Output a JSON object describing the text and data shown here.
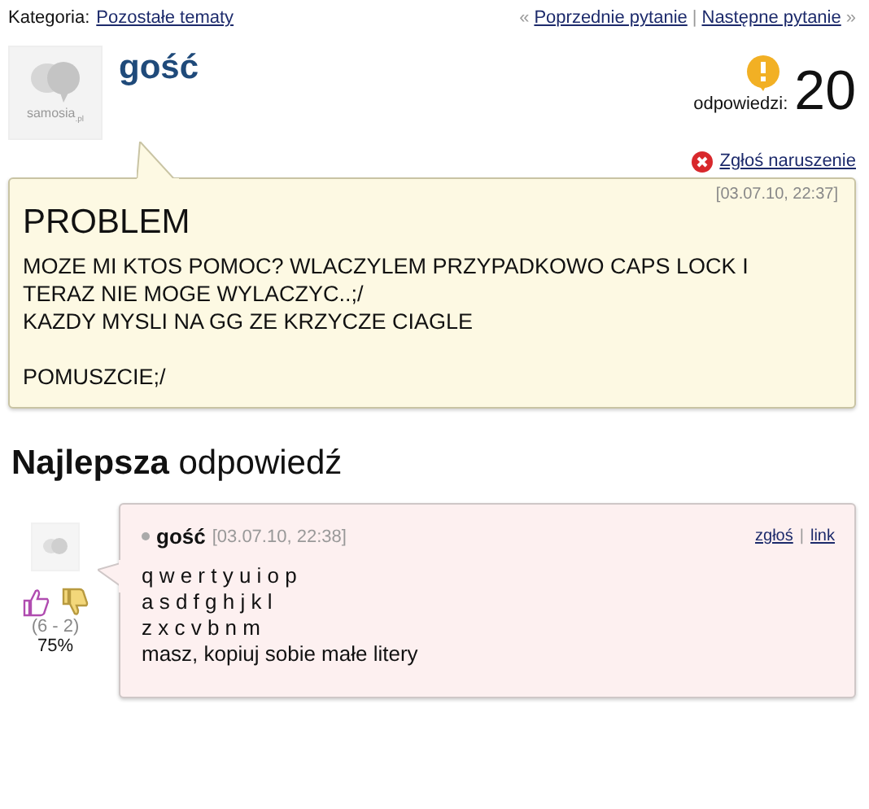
{
  "breadcrumb": {
    "label": "Kategoria:",
    "category": "Pozostałe tematy"
  },
  "nav": {
    "prev_mark": "«",
    "prev": "Poprzednie pytanie",
    "separator": "|",
    "next": "Następne pytanie",
    "next_mark": "»"
  },
  "question": {
    "avatar_text": "samosia",
    "avatar_suffix": ".pl",
    "author": "gość",
    "answers_label": "odpowiedzi:",
    "answers_count": "20",
    "report": "Zgłoś naruszenie",
    "date": "[03.07.10, 22:37]",
    "title": "PROBLEM",
    "paragraphs": [
      [
        "MOZE MI KTOS POMOC? WLACZYLEM PRZYPADKOWO CAPS LOCK I TERAZ NIE MOGE WYLACZYC..;/",
        "KAZDY MYSLI NA GG ZE KRZYCZE CIAGLE"
      ],
      [
        "POMUSZCIE;/"
      ]
    ]
  },
  "best_answer": {
    "heading_bold": "Najlepsza",
    "heading_rest": "odpowiedź",
    "votes": "(6 - 2)",
    "percent": "75%",
    "author": "gość",
    "date": "[03.07.10, 22:38]",
    "report": "zgłoś",
    "separator": "|",
    "link": "link",
    "body_lines": [
      "q w e r t y u i o p",
      "a s d f g h j k l",
      "z x c v b n m",
      "masz, kopiuj sobie małe litery"
    ]
  }
}
